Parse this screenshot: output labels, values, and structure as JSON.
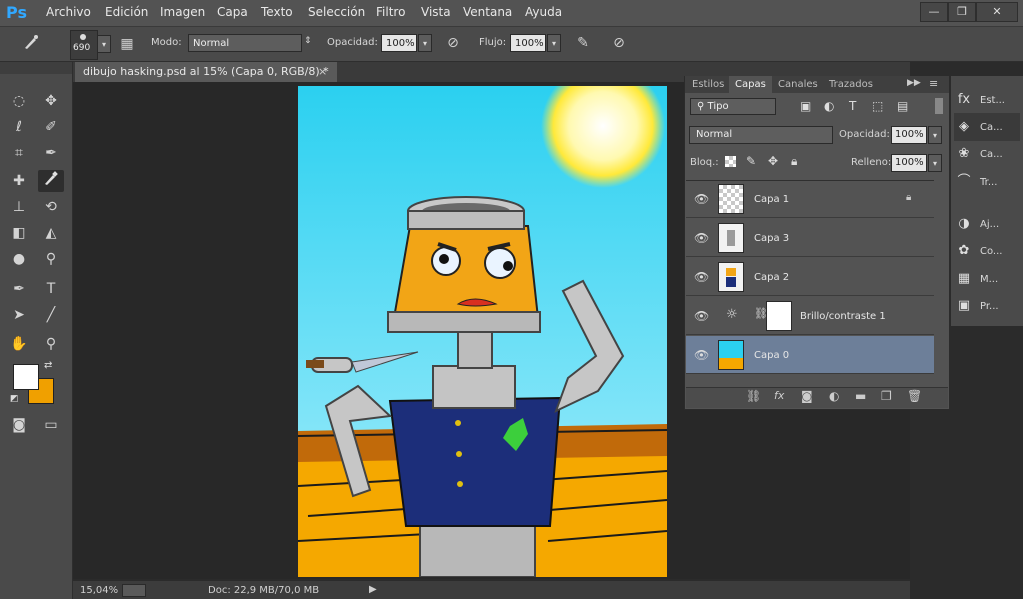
{
  "app": {
    "logo": "Ps",
    "menu": [
      "Archivo",
      "Edición",
      "Imagen",
      "Capa",
      "Texto",
      "Selección",
      "Filtro",
      "Vista",
      "Ventana",
      "Ayuda"
    ],
    "window_controls": [
      "—",
      "❐",
      "✕"
    ]
  },
  "options_bar": {
    "brush_size": "690",
    "mode_label": "Modo:",
    "mode_value": "Normal",
    "opacity_label": "Opacidad:",
    "opacity_value": "100%",
    "flow_label": "Flujo:",
    "flow_value": "100%"
  },
  "document": {
    "tab_title": "dibujo hasking.psd al 15% (Capa 0, RGB/8) *",
    "close": "×"
  },
  "status_bar": {
    "zoom": "15,04%",
    "doc_info": "Doc: 22,9 MB/70,0 MB"
  },
  "layers_panel": {
    "tabs": [
      "Estilos",
      "Capas",
      "Canales",
      "Trazados"
    ],
    "active_tab": "Capas",
    "filter_kind": "Tipo",
    "blend_mode": "Normal",
    "opacity_label": "Opacidad:",
    "opacity_value": "100%",
    "lock_label": "Bloq.:",
    "fill_label": "Relleno:",
    "fill_value": "100%",
    "layers": [
      {
        "name": "Capa 1",
        "locked": true,
        "selected": false
      },
      {
        "name": "Capa 3",
        "locked": false,
        "selected": false
      },
      {
        "name": "Capa 2",
        "locked": false,
        "selected": false
      },
      {
        "name": "Brillo/contraste 1",
        "locked": false,
        "selected": false
      },
      {
        "name": "Capa 0",
        "locked": false,
        "selected": true
      }
    ]
  },
  "right_dock": {
    "items": [
      {
        "label": "Est...",
        "icon": "fx-icon"
      },
      {
        "label": "Ca...",
        "icon": "layers-icon"
      },
      {
        "label": "Ca...",
        "icon": "channels-icon"
      },
      {
        "label": "Tr...",
        "icon": "paths-icon"
      },
      {
        "label": "Aj...",
        "icon": "adjustments-icon"
      },
      {
        "label": "Co...",
        "icon": "color-icon"
      },
      {
        "label": "M...",
        "icon": "swatches-icon"
      },
      {
        "label": "Pr...",
        "icon": "properties-icon"
      }
    ]
  },
  "colors": {
    "foreground": "#ffffff",
    "background": "#f0a000",
    "selected_layer": "#6d7f99",
    "accent": "#31a8ff"
  }
}
